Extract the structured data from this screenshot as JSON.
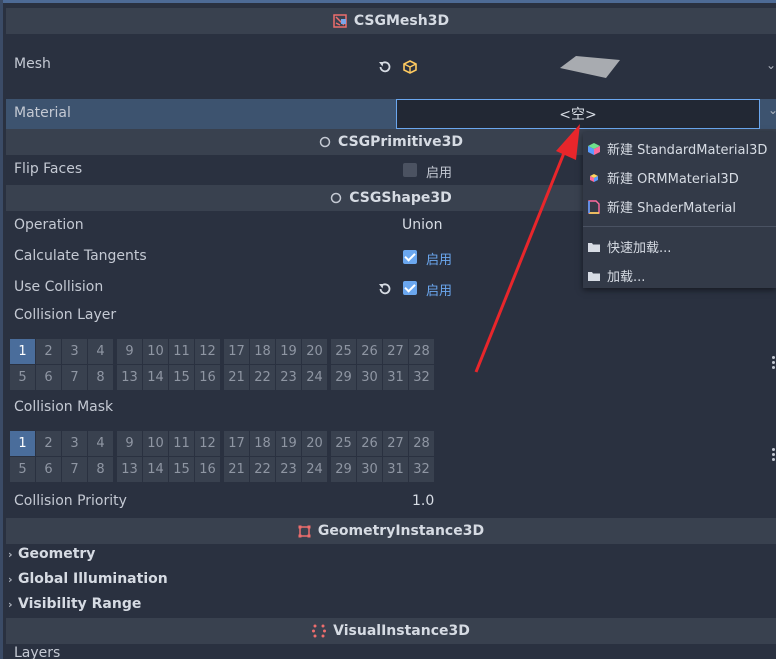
{
  "sections": {
    "csgmesh": "CSGMesh3D",
    "csgprimitive": "CSGPrimitive3D",
    "csgshape": "CSGShape3D",
    "geometry_instance": "GeometryInstance3D",
    "visual_instance": "VisualInstance3D"
  },
  "props": {
    "mesh": "Mesh",
    "material": "Material",
    "material_value": "<空>",
    "flip_faces": "Flip Faces",
    "enable": "启用",
    "operation": "Operation",
    "operation_value": "Union",
    "calculate_tangents": "Calculate Tangents",
    "use_collision": "Use Collision",
    "collision_layer": "Collision Layer",
    "collision_mask": "Collision Mask",
    "collision_priority": "Collision Priority",
    "collision_priority_value": "1.0",
    "layers": "Layers"
  },
  "layer_numbers": {
    "r1": [
      "1",
      "2",
      "3",
      "4",
      "9",
      "10",
      "11",
      "12",
      "17",
      "18",
      "19",
      "20",
      "25",
      "26",
      "27",
      "28"
    ],
    "r2": [
      "5",
      "6",
      "7",
      "8",
      "13",
      "14",
      "15",
      "16",
      "21",
      "22",
      "23",
      "24",
      "29",
      "30",
      "31",
      "32"
    ]
  },
  "collapsibles": {
    "geometry": "Geometry",
    "global_illumination": "Global Illumination",
    "visibility_range": "Visibility Range"
  },
  "menu": {
    "new_standard": "新建 StandardMaterial3D",
    "new_orm": "新建 ORMMaterial3D",
    "new_shader": "新建 ShaderMaterial",
    "quick_load": "快速加载...",
    "load": "加载..."
  },
  "colors": {
    "accent": "#6ba7ef",
    "arrow": "#e8262b",
    "selected_cell": "#4a6d9b"
  }
}
